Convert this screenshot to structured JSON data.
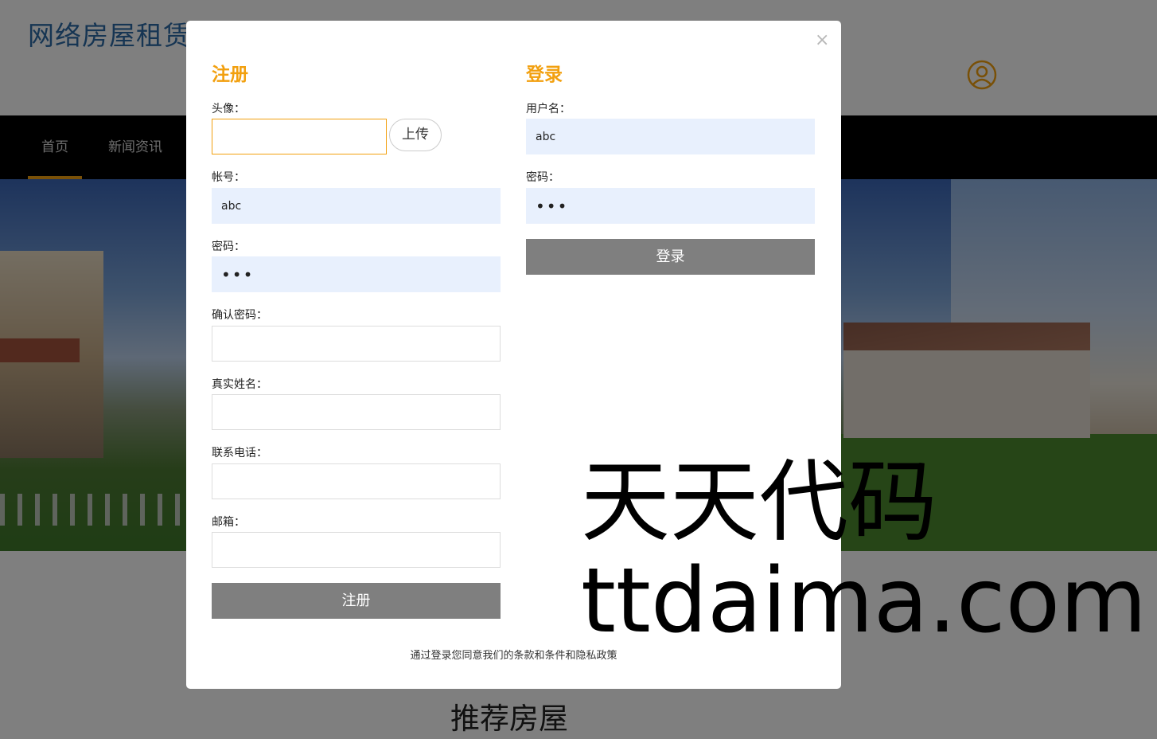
{
  "site": {
    "logo": "网络房屋租赁"
  },
  "nav": {
    "items": [
      {
        "label": "首页"
      },
      {
        "label": "新闻资讯"
      }
    ]
  },
  "section": {
    "title": "推荐房屋"
  },
  "colors": {
    "accent": "#f2a00f",
    "button": "#7f7f7f",
    "autofill": "#e8f0fd"
  },
  "modal": {
    "close_label": "×",
    "register": {
      "title": "注册",
      "avatar_label": "头像：",
      "avatar_value": "",
      "upload_label": "上传",
      "account_label": "帐号：",
      "account_value": "abc",
      "password_label": "密码：",
      "password_value": "•••",
      "confirm_label": "确认密码：",
      "confirm_value": "",
      "realname_label": "真实姓名：",
      "realname_value": "",
      "phone_label": "联系电话：",
      "phone_value": "",
      "email_label": "邮箱：",
      "email_value": "",
      "submit_label": "注册"
    },
    "login": {
      "title": "登录",
      "username_label": "用户名：",
      "username_value": "abc",
      "password_label": "密码：",
      "password_value": "•••",
      "submit_label": "登录"
    },
    "terms": "通过登录您同意我们的条款和条件和隐私政策"
  },
  "watermark": {
    "line1": "天天代码",
    "line2": "ttdaima.com"
  }
}
